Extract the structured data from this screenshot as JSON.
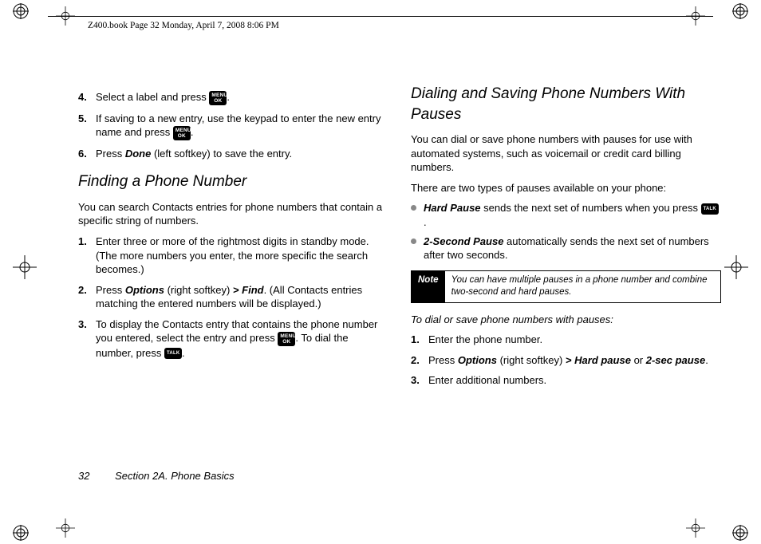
{
  "header": {
    "running_head": "Z400.book  Page 32  Monday, April 7, 2008  8:06 PM"
  },
  "keys": {
    "menuok_line1": "MENU",
    "menuok_line2": "OK",
    "talk": "TALK"
  },
  "left": {
    "step4_a": "Select a label and press ",
    "step4_b": ".",
    "step5_a": "If saving to a new entry, use the keypad to enter the new entry name and press ",
    "step5_b": ".",
    "step6_a": "Press ",
    "step6_done": "Done",
    "step6_b": " (left softkey) to save the entry.",
    "heading": "Finding a Phone Number",
    "intro": "You can search Contacts entries for phone numbers that contain a specific string of numbers.",
    "f1": "Enter three or more of the rightmost digits in standby mode. (The more numbers you enter, the more specific the search becomes.)",
    "f2_a": "Press ",
    "f2_options": "Options",
    "f2_b": " (right softkey) ",
    "f2_gt": ">",
    "f2_find": "Find",
    "f2_c": ". (All Contacts entries matching the entered numbers will be displayed.)",
    "f3_a": "To display the Contacts entry that contains the phone number you entered, select the entry and press ",
    "f3_b": ". To dial the number, press ",
    "f3_c": "."
  },
  "right": {
    "heading": "Dialing and Saving Phone Numbers With Pauses",
    "intro": "You can dial or save phone numbers with pauses for use with automated systems, such as voicemail or credit card billing numbers.",
    "types_intro": "There are two types of pauses available on your phone:",
    "hp_label": "Hard Pause",
    "hp_a": " sends the next set of numbers when you press ",
    "hp_b": ".",
    "sp_label": "2-Second Pause",
    "sp_a": " automatically sends the next set of numbers after two seconds.",
    "note_label": "Note",
    "note_body": "You can have multiple pauses in a phone number and combine two-second and hard pauses.",
    "subhead": "To dial or save phone numbers with pauses:",
    "d1": "Enter the phone number.",
    "d2_a": "Press ",
    "d2_options": "Options",
    "d2_b": " (right softkey) ",
    "d2_gt": ">",
    "d2_hp": "Hard pause",
    "d2_or": " or ",
    "d2_sp": "2-sec pause",
    "d2_c": ".",
    "d3": "Enter additional numbers."
  },
  "nums": {
    "n1": "1.",
    "n2": "2.",
    "n3": "3.",
    "n4": "4.",
    "n5": "5.",
    "n6": "6."
  },
  "footer": {
    "page_number": "32",
    "section": "Section 2A. Phone Basics"
  }
}
